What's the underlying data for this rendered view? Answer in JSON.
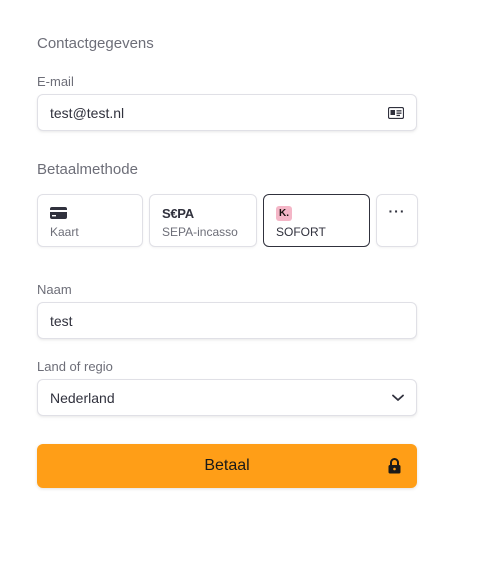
{
  "contact": {
    "title": "Contactgegevens",
    "email_label": "E-mail",
    "email_value": "test@test.nl"
  },
  "payment": {
    "title": "Betaalmethode",
    "methods": [
      {
        "label": "Kaart",
        "icon": "card-icon"
      },
      {
        "label": "SEPA-incasso",
        "icon": "sepa-icon",
        "logo_text": "S€PA"
      },
      {
        "label": "SOFORT",
        "icon": "klarna-icon",
        "logo_text": "K.",
        "selected": true
      }
    ],
    "more_label": "···"
  },
  "name": {
    "label": "Naam",
    "value": "test"
  },
  "country": {
    "label": "Land of regio",
    "value": "Nederland"
  },
  "submit": {
    "label": "Betaal"
  },
  "colors": {
    "accent": "#ff9e17",
    "klarna_pink": "#f4b6c7",
    "text": "#30313d",
    "muted": "#6d6e78",
    "border": "#e0e0e6"
  }
}
